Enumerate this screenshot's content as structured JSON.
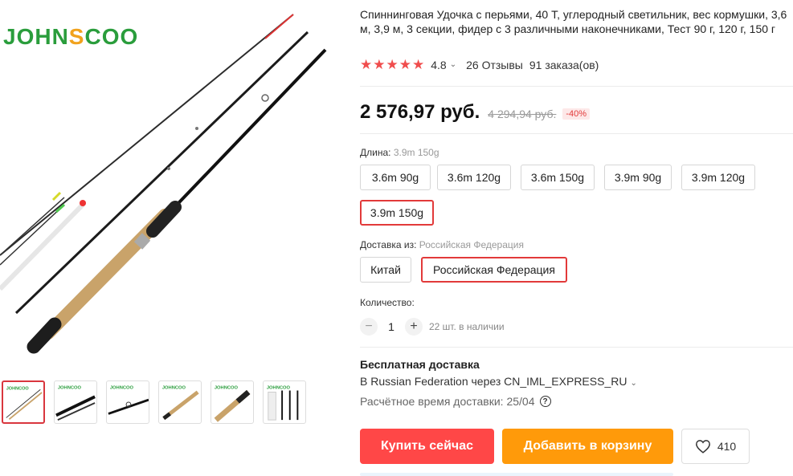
{
  "brand": {
    "logo_text_a": "JOHN",
    "logo_text_hook": "S",
    "logo_text_b": "COO"
  },
  "product": {
    "title": "Спиннинговая Удочка с перьями, 40 Т, углеродный светильник, вес кормушки, 3,6 м, 3,9 м, 3 секции, фидер с 3 различными наконечниками, Тест 90 г, 120 г, 150 г",
    "rating": "4.8",
    "reviews": "26 Отзывы",
    "orders": "91 заказа(ов)",
    "star_count": 5
  },
  "price": {
    "current": "2 576,97 руб.",
    "old": "4 294,94 руб.",
    "discount": "-40%"
  },
  "length": {
    "label": "Длина:",
    "selected": "3.9m 150g",
    "options": [
      "3.6m 90g",
      "3.6m 120g",
      "3.6m 150g",
      "3.9m 90g",
      "3.9m 120g",
      "3.9m 150g"
    ]
  },
  "ship_from": {
    "label": "Доставка из:",
    "selected": "Российская Федерация",
    "options": [
      "Китай",
      "Российская Федерация"
    ]
  },
  "quantity": {
    "label": "Количество:",
    "value": "1",
    "minus": "−",
    "plus": "+",
    "stock": "22 шт. в наличии"
  },
  "shipping": {
    "title": "Бесплатная доставка",
    "method": "В Russian Federation через CN_IML_EXPRESS_RU",
    "eta": "Расчётное время доставки: 25/04",
    "help": "?"
  },
  "actions": {
    "buy": "Купить сейчас",
    "cart": "Добавить в корзину",
    "wishlist_count": "410"
  },
  "colors": {
    "accent_red": "#ff4747",
    "cart_orange": "#ff9a0a",
    "star": "#f04d4d",
    "logo_green": "#2a9d3c",
    "logo_hook": "#f1a21d"
  },
  "icons": {
    "star": "★",
    "chevron": "⌄",
    "heart": "heart-icon"
  },
  "thumbnails": [
    "thumbnail-1",
    "thumbnail-2",
    "thumbnail-3",
    "thumbnail-4",
    "thumbnail-5",
    "thumbnail-6"
  ]
}
